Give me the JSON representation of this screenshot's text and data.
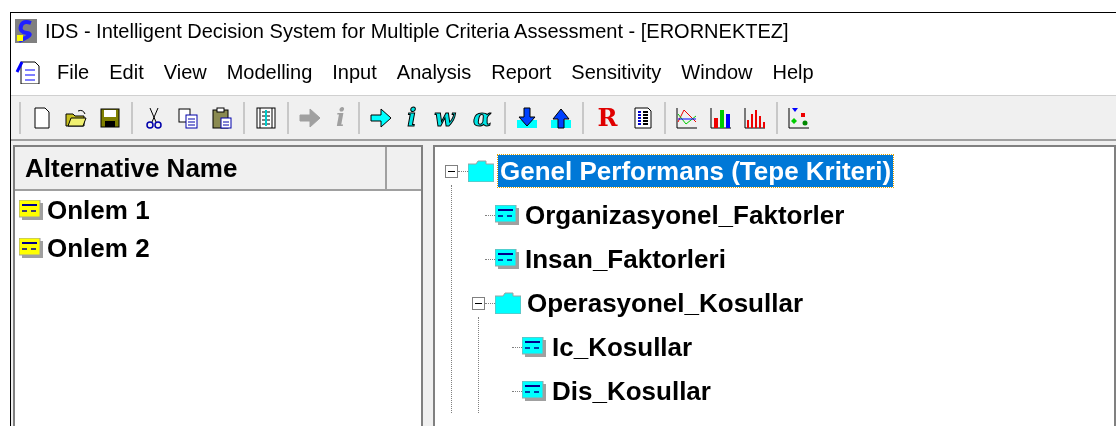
{
  "window": {
    "title": "IDS - Intelligent Decision System for Multiple Criteria Assessment - [ERORNEKTEZ]"
  },
  "menu": [
    "File",
    "Edit",
    "View",
    "Modelling",
    "Input",
    "Analysis",
    "Report",
    "Sensitivity",
    "Window",
    "Help"
  ],
  "toolbar": [
    [
      {
        "kind": "new"
      },
      {
        "kind": "open"
      },
      {
        "kind": "save"
      }
    ],
    [
      {
        "kind": "cut"
      },
      {
        "kind": "copy"
      },
      {
        "kind": "paste"
      }
    ],
    [
      {
        "kind": "list"
      }
    ],
    [
      {
        "kind": "arrow",
        "disabled": true
      },
      {
        "kind": "glyph",
        "text": "i",
        "disabled": true
      }
    ],
    [
      {
        "kind": "arrow",
        "disabled": false
      },
      {
        "kind": "glyph",
        "text": "i",
        "disabled": false
      },
      {
        "kind": "glyph",
        "text": "w",
        "disabled": false
      },
      {
        "kind": "glyph",
        "text": "α",
        "disabled": false
      }
    ],
    [
      {
        "kind": "down"
      },
      {
        "kind": "up"
      }
    ],
    [
      {
        "kind": "letter",
        "text": "R"
      },
      {
        "kind": "report"
      }
    ],
    [
      {
        "kind": "linechart"
      },
      {
        "kind": "barchart"
      },
      {
        "kind": "redbars"
      }
    ],
    [
      {
        "kind": "scatter"
      }
    ]
  ],
  "alternatives": {
    "header": "Alternative Name",
    "rows": [
      "Onlem 1",
      "Onlem 2"
    ]
  },
  "tree": [
    {
      "label": "Genel Performans (Tepe Kriteri)",
      "selected": true,
      "expanded": true,
      "children": [
        {
          "label": "Organizasyonel_Faktorler",
          "selected": false
        },
        {
          "label": "Insan_Faktorleri",
          "selected": false
        },
        {
          "label": "Operasyonel_Kosullar",
          "selected": false,
          "expanded": true,
          "children": [
            {
              "label": "Ic_Kosullar",
              "selected": false
            },
            {
              "label": "Dis_Kosullar",
              "selected": false
            }
          ]
        }
      ]
    }
  ]
}
